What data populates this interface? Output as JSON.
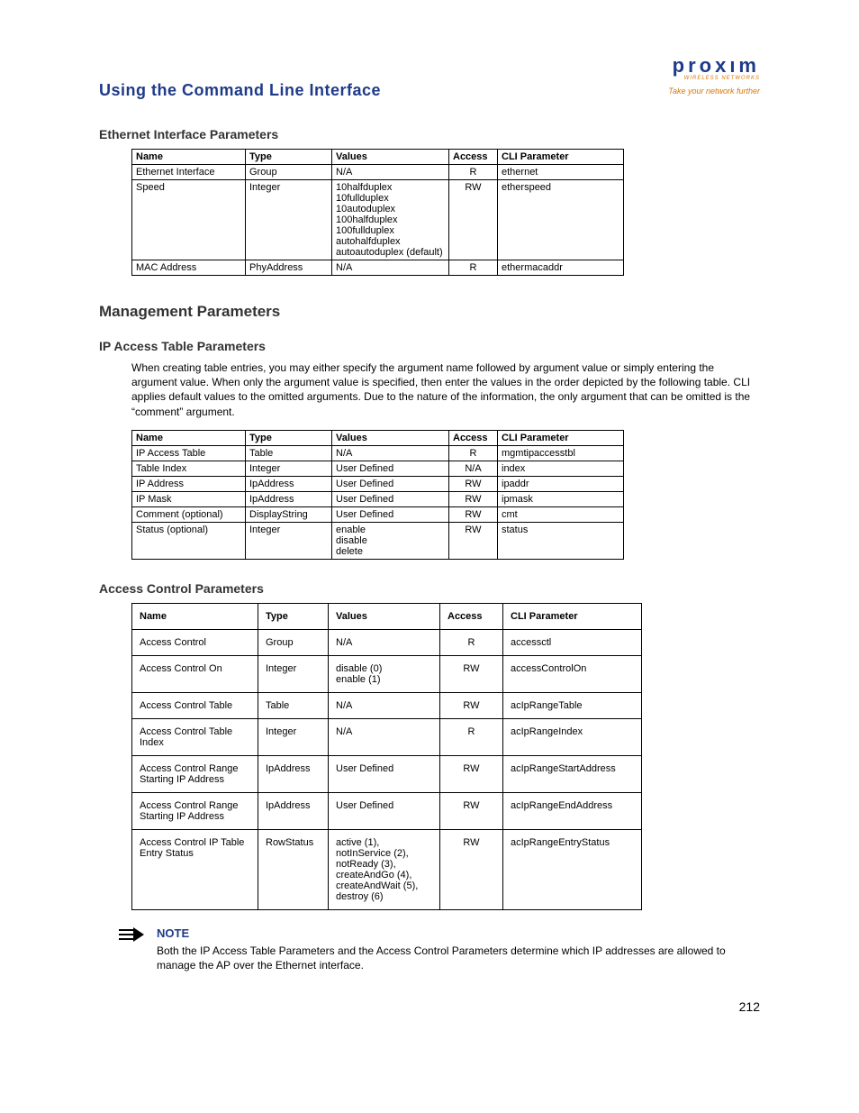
{
  "header": {
    "page_title": "Using the Command Line Interface",
    "brand_logo": "proxım",
    "brand_sub": "WIRELESS NETWORKS",
    "brand_tag": "Take your network further"
  },
  "section1": {
    "heading": "Ethernet Interface Parameters",
    "cols": [
      "Name",
      "Type",
      "Values",
      "Access",
      "CLI Parameter"
    ],
    "rows": [
      {
        "name": "Ethernet Interface",
        "type": "Group",
        "values": "N/A",
        "access": "R",
        "cli": "ethernet"
      },
      {
        "name": "Speed",
        "type": "Integer",
        "values": "10halfduplex\n10fullduplex\n10autoduplex\n100halfduplex\n100fullduplex\nautohalfduplex\nautoautoduplex (default)",
        "access": "RW",
        "cli": "etherspeed"
      },
      {
        "name": "MAC Address",
        "type": "PhyAddress",
        "values": "N/A",
        "access": "R",
        "cli": "ethermacaddr"
      }
    ]
  },
  "section2": {
    "heading": "Management Parameters"
  },
  "section3": {
    "heading": "IP Access Table Parameters",
    "intro": "When creating table entries, you may either specify the argument name followed by argument value or simply entering the argument value. When only the argument value is specified, then enter the values in the order depicted by the following table. CLI applies default values to the omitted arguments. Due to the nature of the information, the only argument that can be omitted is the “comment” argument.",
    "cols": [
      "Name",
      "Type",
      "Values",
      "Access",
      "CLI Parameter"
    ],
    "rows": [
      {
        "name": "IP Access Table",
        "type": "Table",
        "values": "N/A",
        "access": "R",
        "cli": "mgmtipaccesstbl"
      },
      {
        "name": "Table Index",
        "type": "Integer",
        "values": "User Defined",
        "access": "N/A",
        "cli": "index"
      },
      {
        "name": "IP Address",
        "type": "IpAddress",
        "values": "User Defined",
        "access": "RW",
        "cli": "ipaddr"
      },
      {
        "name": "IP Mask",
        "type": "IpAddress",
        "values": "User Defined",
        "access": "RW",
        "cli": "ipmask"
      },
      {
        "name": "Comment (optional)",
        "type": "DisplayString",
        "values": "User Defined",
        "access": "RW",
        "cli": "cmt"
      },
      {
        "name": "Status (optional)",
        "type": "Integer",
        "values": "enable\ndisable\ndelete",
        "access": "RW",
        "cli": "status"
      }
    ]
  },
  "section4": {
    "heading": "Access Control Parameters",
    "cols": [
      "Name",
      "Type",
      "Values",
      "Access",
      "CLI Parameter"
    ],
    "rows": [
      {
        "name": "Access Control",
        "type": "Group",
        "values": "N/A",
        "access": "R",
        "cli": "accessctl"
      },
      {
        "name": "Access Control On",
        "type": "Integer",
        "values": "disable (0)\nenable (1)",
        "access": "RW",
        "cli": "accessControlOn"
      },
      {
        "name": "Access Control Table",
        "type": "Table",
        "values": "N/A",
        "access": "RW",
        "cli": "acIpRangeTable"
      },
      {
        "name": "Access Control Table Index",
        "type": "Integer",
        "values": "N/A",
        "access": "R",
        "cli": "acIpRangeIndex"
      },
      {
        "name": "Access Control Range Starting IP Address",
        "type": "IpAddress",
        "values": "User Defined",
        "access": "RW",
        "cli": "acIpRangeStartAddress"
      },
      {
        "name": "Access Control Range Starting IP Address",
        "type": "IpAddress",
        "values": "User Defined",
        "access": "RW",
        "cli": "acIpRangeEndAddress"
      },
      {
        "name": "Access Control IP Table Entry Status",
        "type": "RowStatus",
        "values": "active (1),\nnotInService (2),\nnotReady (3),\ncreateAndGo (4),\ncreateAndWait (5),\ndestroy (6)",
        "access": "RW",
        "cli": "acIpRangeEntryStatus"
      }
    ]
  },
  "note": {
    "label": "NOTE",
    "text": "Both the IP Access Table Parameters and the Access Control Parameters determine which IP addresses are allowed to manage the AP over the Ethernet interface."
  },
  "page_number": "212"
}
